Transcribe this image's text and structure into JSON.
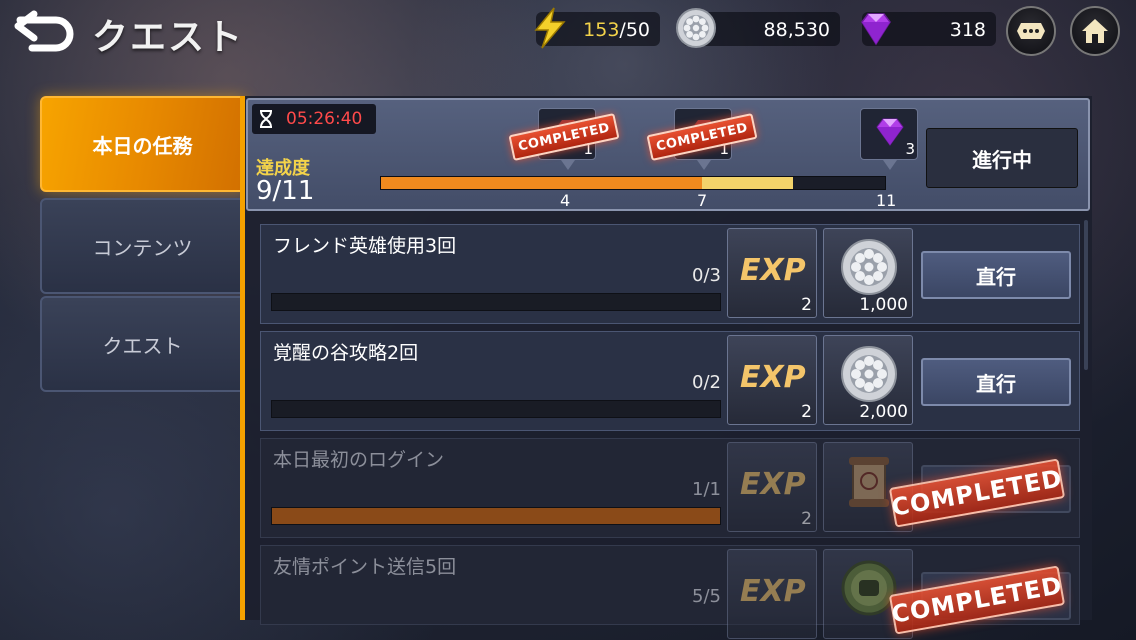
{
  "header": {
    "title": "クエスト",
    "stamina_current": "153",
    "stamina_max": "/50",
    "silver": "88,530",
    "gems": "318"
  },
  "tabs": [
    {
      "label": "本日の任務",
      "active": true
    },
    {
      "label": "コンテンツ",
      "active": false
    },
    {
      "label": "クエスト",
      "active": false
    }
  ],
  "summary": {
    "timer": "05:26:40",
    "achievement_label": "達成度",
    "achievement_value": "9/11",
    "progress_fraction": 0.818,
    "milestones": [
      {
        "at": "4",
        "reward_count": "1",
        "stamp": "COMPLETED"
      },
      {
        "at": "7",
        "reward_count": "1",
        "stamp": "COMPLETED"
      },
      {
        "at": "11",
        "reward_count": "3",
        "reward_icon": "gem-icon"
      }
    ],
    "status_button": "進行中"
  },
  "quests": [
    {
      "name": "フレンド英雄使用3回",
      "progress": "0/3",
      "fraction": 0,
      "exp_label": "EXP",
      "exp": "2",
      "reward_icon": "silver-coin-icon",
      "reward": "1,000",
      "button": "直行",
      "completed": false
    },
    {
      "name": "覚醒の谷攻略2回",
      "progress": "0/2",
      "fraction": 0,
      "exp_label": "EXP",
      "exp": "2",
      "reward_icon": "silver-coin-icon",
      "reward": "2,000",
      "button": "直行",
      "completed": false
    },
    {
      "name": "本日最初のログイン",
      "progress": "1/1",
      "fraction": 1,
      "exp_label": "EXP",
      "exp": "2",
      "reward_icon": "scroll-icon",
      "reward": "",
      "button": "",
      "completed": true,
      "stamp": "COMPLETED"
    },
    {
      "name": "友情ポイント送信5回",
      "progress": "5/5",
      "fraction": 1,
      "exp_label": "EXP",
      "exp": "",
      "reward_icon": "friendship-fist-icon",
      "reward": "",
      "button": "",
      "completed": true,
      "stamp": "COMPLETED"
    }
  ],
  "colors": {
    "accent": "#f5a100",
    "timer": "#ff4a4a",
    "stamp": "#d23a1c"
  }
}
